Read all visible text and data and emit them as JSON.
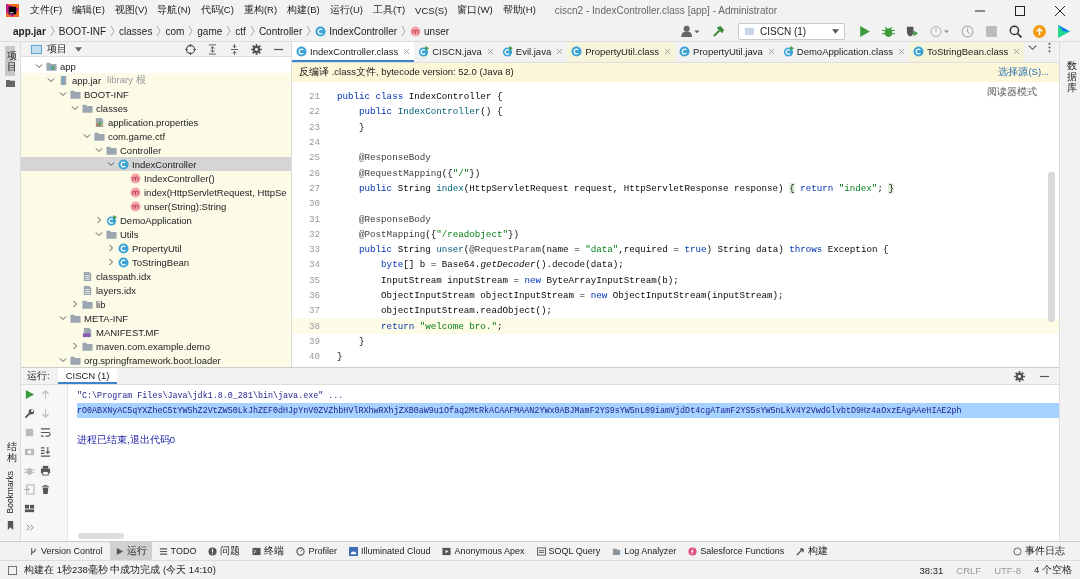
{
  "window": {
    "title": "ciscn2 - IndexController.class [app] - Administrator"
  },
  "menu": [
    "文件(F)",
    "编辑(E)",
    "视图(V)",
    "导航(N)",
    "代码(C)",
    "重构(R)",
    "构建(B)",
    "运行(U)",
    "工具(T)",
    "VCS(S)",
    "窗口(W)",
    "帮助(H)"
  ],
  "breadcrumbs": [
    {
      "label": "app.jar",
      "kind": "root"
    },
    {
      "label": "BOOT-INF",
      "kind": "dir"
    },
    {
      "label": "classes",
      "kind": "dir"
    },
    {
      "label": "com",
      "kind": "dir"
    },
    {
      "label": "game",
      "kind": "dir"
    },
    {
      "label": "ctf",
      "kind": "dir"
    },
    {
      "label": "Controller",
      "kind": "dir"
    },
    {
      "label": "IndexController",
      "kind": "class"
    },
    {
      "label": "unser",
      "kind": "method"
    }
  ],
  "run_config": {
    "value": "CISCN (1)"
  },
  "left_strip": {
    "top": [
      {
        "label": "项目",
        "selected": true
      }
    ],
    "bottom": [
      {
        "label": "结构",
        "selected": false
      },
      {
        "label": "Bookmarks",
        "selected": false
      }
    ]
  },
  "project_panel": {
    "title": "项目"
  },
  "tree": [
    {
      "label": "app",
      "kind": "module",
      "expanded": true,
      "selected": false,
      "children": [
        {
          "label": "app.jar",
          "hint": "library 根",
          "kind": "jar",
          "expanded": true,
          "selected": false,
          "children": [
            {
              "label": "BOOT-INF",
              "kind": "folder",
              "expanded": true,
              "selected": false,
              "children": [
                {
                  "label": "classes",
                  "kind": "folder",
                  "expanded": true,
                  "selected": false,
                  "children": [
                    {
                      "label": "application.properties",
                      "kind": "properties",
                      "selected": false
                    },
                    {
                      "label": "com.game.ctf",
                      "kind": "folder",
                      "expanded": true,
                      "selected": false,
                      "children": [
                        {
                          "label": "Controller",
                          "kind": "folder",
                          "expanded": true,
                          "selected": false,
                          "children": [
                            {
                              "label": "IndexController",
                              "kind": "class",
                              "expanded": true,
                              "selected": true,
                              "children": [
                                {
                                  "label": "IndexController()",
                                  "kind": "method",
                                  "selected": false
                                },
                                {
                                  "label": "index(HttpServletRequest, HttpSe",
                                  "kind": "method",
                                  "selected": false
                                },
                                {
                                  "label": "unser(String):String",
                                  "kind": "method",
                                  "selected": false
                                }
                              ]
                            }
                          ]
                        },
                        {
                          "label": "DemoApplication",
                          "kind": "runnable",
                          "expanded": false,
                          "selected": false
                        },
                        {
                          "label": "Utils",
                          "kind": "folder",
                          "expanded": true,
                          "selected": false,
                          "children": [
                            {
                              "label": "PropertyUtil",
                              "kind": "class",
                              "expanded": false,
                              "selected": false
                            },
                            {
                              "label": "ToStringBean",
                              "kind": "class",
                              "expanded": false,
                              "selected": false
                            }
                          ]
                        }
                      ]
                    }
                  ]
                },
                {
                  "label": "classpath.idx",
                  "kind": "file",
                  "selected": false
                },
                {
                  "label": "layers.idx",
                  "kind": "file",
                  "selected": false
                },
                {
                  "label": "lib",
                  "kind": "folder",
                  "expanded": false,
                  "selected": false
                }
              ]
            },
            {
              "label": "META-INF",
              "kind": "folder",
              "expanded": true,
              "selected": false,
              "children": [
                {
                  "label": "MANIFEST.MF",
                  "kind": "manifest",
                  "selected": false
                },
                {
                  "label": "maven.com.example.demo",
                  "kind": "folder",
                  "expanded": false,
                  "selected": false
                }
              ]
            },
            {
              "label": "org.springframework.boot.loader",
              "kind": "folder",
              "expanded": true,
              "selected": false
            }
          ]
        }
      ]
    }
  ],
  "tabs": [
    {
      "label": "IndexController.class",
      "kind": "class",
      "tinted": false,
      "selected": true
    },
    {
      "label": "CISCN.java",
      "kind": "runnable",
      "tinted": false,
      "selected": false
    },
    {
      "label": "Evil.java",
      "kind": "runnable",
      "tinted": false,
      "selected": false
    },
    {
      "label": "PropertyUtil.class",
      "kind": "class",
      "tinted": true,
      "selected": false
    },
    {
      "label": "PropertyUtil.java",
      "kind": "class",
      "tinted": false,
      "selected": false
    },
    {
      "label": "DemoApplication.class",
      "kind": "runnable",
      "tinted": false,
      "selected": false
    },
    {
      "label": "ToStringBean.class",
      "kind": "class",
      "tinted": true,
      "selected": false
    }
  ],
  "editor": {
    "banner": "反编译 .class文件, bytecode version: 52.0 (Java 8)",
    "banner_link": "选择源(S)...",
    "reader_mode": "阅读器模式",
    "lines": [
      {
        "number": "21",
        "current": false,
        "tokens": [
          {
            "kind": "kw",
            "text": "public class "
          },
          {
            "kind": "plain",
            "text": "IndexController {"
          }
        ]
      },
      {
        "number": "22",
        "current": false,
        "tokens": [
          {
            "kind": "kw",
            "text": "    public "
          },
          {
            "kind": "fn",
            "text": "IndexController"
          },
          {
            "kind": "plain",
            "text": "() {"
          }
        ]
      },
      {
        "number": "23",
        "current": false,
        "tokens": [
          {
            "kind": "plain",
            "text": "    }"
          }
        ]
      },
      {
        "number": "24",
        "current": false
      },
      {
        "number": "25",
        "current": false,
        "tokens": [
          {
            "kind": "ann",
            "text": "    @ResponseBody"
          }
        ]
      },
      {
        "number": "26",
        "current": false,
        "tokens": [
          {
            "kind": "ann",
            "text": "    @RequestMapping"
          },
          {
            "kind": "plain",
            "text": "({"
          },
          {
            "kind": "str",
            "text": "\"/\""
          },
          {
            "kind": "plain",
            "text": "})"
          }
        ]
      },
      {
        "number": "27",
        "current": false,
        "tokens": [
          {
            "kind": "kw",
            "text": "    public "
          },
          {
            "kind": "plain",
            "text": "String "
          },
          {
            "kind": "fn",
            "text": "index"
          },
          {
            "kind": "plain",
            "text": "(HttpServletRequest request, HttpServletResponse response) "
          },
          {
            "kind": "fold",
            "text": "{"
          },
          {
            "kind": "kw",
            "text": " return "
          },
          {
            "kind": "str",
            "text": "\"index\""
          },
          {
            "kind": "plain",
            "text": "; "
          },
          {
            "kind": "fold",
            "text": "}"
          }
        ]
      },
      {
        "number": "30",
        "current": false
      },
      {
        "number": "31",
        "current": false,
        "tokens": [
          {
            "kind": "ann",
            "text": "    @ResponseBody"
          }
        ]
      },
      {
        "number": "32",
        "current": false,
        "tokens": [
          {
            "kind": "ann",
            "text": "    @PostMapping"
          },
          {
            "kind": "plain",
            "text": "({"
          },
          {
            "kind": "str",
            "text": "\"/readobject\""
          },
          {
            "kind": "plain",
            "text": "})"
          }
        ]
      },
      {
        "number": "33",
        "current": false,
        "tokens": [
          {
            "kind": "kw",
            "text": "    public "
          },
          {
            "kind": "plain",
            "text": "String "
          },
          {
            "kind": "fn",
            "text": "unser"
          },
          {
            "kind": "plain",
            "text": "("
          },
          {
            "kind": "ann",
            "text": "@RequestParam"
          },
          {
            "kind": "plain",
            "text": "(name = "
          },
          {
            "kind": "str",
            "text": "\"data\""
          },
          {
            "kind": "plain",
            "text": ",required = "
          },
          {
            "kind": "kw",
            "text": "true"
          },
          {
            "kind": "plain",
            "text": ") String data) "
          },
          {
            "kind": "kw",
            "text": "throws "
          },
          {
            "kind": "plain",
            "text": "Exception {"
          }
        ]
      },
      {
        "number": "34",
        "current": false,
        "tokens": [
          {
            "kind": "kw",
            "text": "        byte"
          },
          {
            "kind": "plain",
            "text": "[] b = Base64."
          },
          {
            "kind": "italic",
            "text": "getDecoder"
          },
          {
            "kind": "plain",
            "text": "().decode(data);"
          }
        ]
      },
      {
        "number": "35",
        "current": false,
        "tokens": [
          {
            "kind": "plain",
            "text": "        InputStream inputStream = "
          },
          {
            "kind": "kw",
            "text": "new "
          },
          {
            "kind": "plain",
            "text": "ByteArrayInputStream(b);"
          }
        ]
      },
      {
        "number": "36",
        "current": false,
        "tokens": [
          {
            "kind": "plain",
            "text": "        ObjectInputStream objectInputStream = "
          },
          {
            "kind": "kw",
            "text": "new "
          },
          {
            "kind": "plain",
            "text": "ObjectInputStream(inputStream);"
          }
        ]
      },
      {
        "number": "37",
        "current": false,
        "tokens": [
          {
            "kind": "plain",
            "text": "        objectInputStream.readObject();"
          }
        ]
      },
      {
        "number": "38",
        "current": true,
        "tokens": [
          {
            "kind": "kw",
            "text": "        return "
          },
          {
            "kind": "str",
            "text": "\"welcome bro.\""
          },
          {
            "kind": "plain",
            "text": ";"
          }
        ]
      },
      {
        "number": "39",
        "current": false,
        "tokens": [
          {
            "kind": "plain",
            "text": "    }"
          }
        ]
      },
      {
        "number": "40",
        "current": false,
        "tokens": [
          {
            "kind": "plain",
            "text": "}"
          }
        ]
      }
    ]
  },
  "run_panel": {
    "label": "运行:",
    "tab": "CISCN (1)",
    "console": [
      {
        "kind": "command",
        "text": "\"C:\\Program Files\\Java\\jdk1.8.0_281\\bin\\java.exe\" ...",
        "selected": false
      },
      {
        "kind": "output",
        "text": "rO0ABXNyAC5qYXZheC5tYW5hZ2VtZW50LkJhZEF0dHJpYnV0ZVZhbHVlRXhwRXhjZXB0aW9u1Ofaq2MtRkACAAFMAAN2YWx0ABJMamF2YS9sYW5nL09iamVjdDt4cgATamF2YS5sYW5nLkV4Y2VwdGlvbtD9Hz4aOxzEAgAAeHIAE2ph",
        "selected": true
      },
      {
        "kind": "system",
        "text": "进程已结束,退出代码0",
        "selected": false
      }
    ]
  },
  "tool_windows": [
    {
      "label": "Version Control",
      "kind": "vcs",
      "selected": false
    },
    {
      "label": "运行",
      "kind": "run",
      "selected": true
    },
    {
      "label": "TODO",
      "kind": "list",
      "selected": false
    },
    {
      "label": "问题",
      "kind": "problem",
      "selected": false
    },
    {
      "label": "终端",
      "kind": "terminal",
      "selected": false
    },
    {
      "label": "Profiler",
      "kind": "profiler",
      "selected": false
    },
    {
      "label": "Illuminated Cloud",
      "kind": "cloud",
      "selected": false
    },
    {
      "label": "Anonymous Apex",
      "kind": "apex",
      "selected": false
    },
    {
      "label": "SOQL Query",
      "kind": "soql",
      "selected": false
    },
    {
      "label": "Log Analyzer",
      "kind": "log",
      "selected": false
    },
    {
      "label": "Salesforce Functions",
      "kind": "salesforce",
      "selected": false
    },
    {
      "label": "构建",
      "kind": "hammer",
      "selected": false
    }
  ],
  "event_log": "事件日志",
  "status_bar": {
    "message": "构建在 1秒238毫秒 中成功完成 (今天 14:10)",
    "position": "38:31",
    "line_separator": "CRLF",
    "encoding": "UTF-8",
    "indent": "4 个空格"
  },
  "right_strip": [
    {
      "label": "数据库",
      "selected": false
    }
  ]
}
